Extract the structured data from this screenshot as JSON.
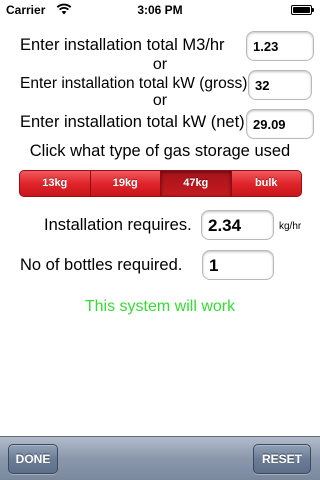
{
  "status_bar": {
    "carrier": "Carrier",
    "time": "3:06 PM"
  },
  "form": {
    "m3_label": "Enter installation total  M3/hr",
    "m3_value": "1.23",
    "or_1": "or",
    "kw_gross_label": "Enter installation total  kW (gross)",
    "kw_gross_value": "32",
    "or_2": "or",
    "kw_net_label": "Enter installation total  kW (net)",
    "kw_net_value": "29.09"
  },
  "gas_storage": {
    "prompt": "Click what type of gas storage used",
    "options": [
      "13kg",
      "19kg",
      "47kg",
      "bulk"
    ],
    "selected": "47kg"
  },
  "results": {
    "requires_label": "Installation requires.",
    "requires_value": "2.34",
    "requires_unit": "kg/hr",
    "bottles_label": "No of bottles required.",
    "bottles_value": "1",
    "status_message": "This system will work",
    "status_color": "#33dd33"
  },
  "toolbar": {
    "done_label": "DONE",
    "reset_label": "RESET"
  }
}
